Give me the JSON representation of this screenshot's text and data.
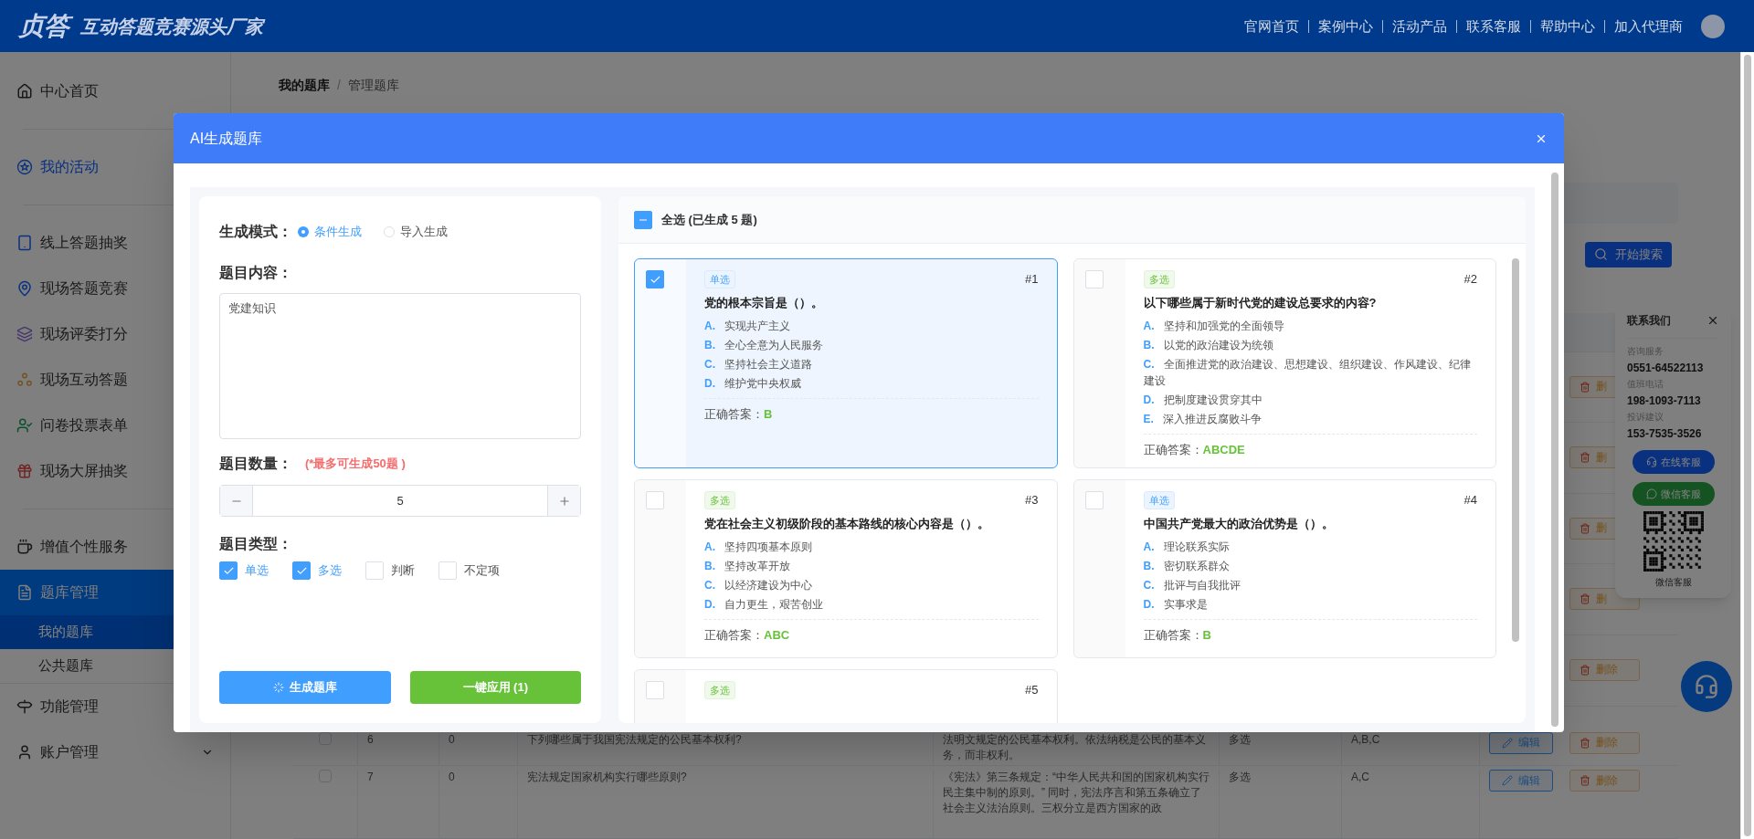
{
  "header": {
    "logo": "贞答",
    "slogan": "互动答题竞赛源头厂家",
    "nav": [
      "官网首页",
      "案例中心",
      "活动产品",
      "联系客服",
      "帮助中心",
      "加入代理商"
    ]
  },
  "sidebar": [
    {
      "kind": "link",
      "label": "中心首页"
    },
    {
      "kind": "divider"
    },
    {
      "kind": "accent",
      "label": "我的活动"
    },
    {
      "kind": "divider"
    },
    {
      "kind": "link",
      "label": "线上答题抽奖"
    },
    {
      "kind": "link",
      "label": "现场答题竞赛"
    },
    {
      "kind": "link",
      "label": "现场评委打分"
    },
    {
      "kind": "link",
      "label": "现场互动答题"
    },
    {
      "kind": "link",
      "label": "问卷投票表单"
    },
    {
      "kind": "link",
      "label": "现场大屏抽奖"
    },
    {
      "kind": "divider"
    },
    {
      "kind": "link",
      "label": "增值个性服务"
    },
    {
      "kind": "group",
      "label": "题库管理",
      "expanded": true,
      "children": [
        {
          "label": "我的题库",
          "selected": true
        },
        {
          "label": "公共题库",
          "selected": false
        }
      ]
    },
    {
      "kind": "link",
      "label": "功能管理"
    },
    {
      "kind": "group",
      "label": "账户管理",
      "expanded": false
    }
  ],
  "breadcrumb": [
    "我的题库",
    "/",
    "管理题库"
  ],
  "search_button": "开始搜索",
  "table_rows": [
    {
      "delete": "删"
    },
    {
      "delete": "删"
    },
    {
      "delete": "删"
    },
    {
      "delete": "删"
    },
    {
      "delete": "删除"
    },
    {
      "checked": false,
      "number": "6",
      "column_3": "0",
      "question": "下列哪些属于我国宪法规定的公民基本权利?",
      "explanation": "法明文规定的公民基本权利。依法纳税是公民的基本义务，而非权利。",
      "type": "多选",
      "answer": "A,B,C",
      "edit": "编辑",
      "delete": "删除"
    },
    {
      "checked": false,
      "number": "7",
      "column_3": "0",
      "question": "宪法规定国家机构实行哪些原则?",
      "explanation": "《宪法》第三条规定：“中华人民共和国的国家机构实行民主集中制的原则。” 同时，宪法序言和第五条确立了社会主义法治原则。三权分立是西方国家的政",
      "type": "多选",
      "answer": "A,C",
      "edit": "编辑",
      "delete": "删除"
    }
  ],
  "contact": {
    "title": "联系我们",
    "entries": [
      {
        "label": "咨询服务",
        "value": "0551-64522113"
      },
      {
        "label": "值班电话",
        "value": "198-1093-7113"
      },
      {
        "label": "投诉建议",
        "value": "153-7535-3526"
      }
    ],
    "online_button": "在线客服",
    "wechat_button": "微信客服",
    "qr_caption": "微信客服"
  },
  "modal": {
    "title": "AI生成题库",
    "mode_label": "生成模式：",
    "modes": [
      {
        "label": "条件生成",
        "selected": true
      },
      {
        "label": "导入生成",
        "selected": false
      }
    ],
    "content_label": "题目内容：",
    "content_value": "党建知识",
    "count_label": "题目数量：",
    "count_hint": "(*最多可生成50题 )",
    "count_value": "5",
    "type_label": "题目类型：",
    "types": [
      {
        "label": "单选",
        "checked": true
      },
      {
        "label": "多选",
        "checked": true
      },
      {
        "label": "判断",
        "checked": false
      },
      {
        "label": "不定项",
        "checked": false
      }
    ],
    "generate_button": "生成题库",
    "apply_button": "一键应用 (1)",
    "select_all": {
      "label": "全选 (已生成 5 题)",
      "indeterminate": true
    },
    "questions": [
      {
        "number": "#1",
        "tag": "单选",
        "kind": "single",
        "selected": true,
        "question": "党的根本宗旨是（）。",
        "options": [
          {
            "letter": "A.",
            "text": "实现共产主义"
          },
          {
            "letter": "B.",
            "text": "全心全意为人民服务"
          },
          {
            "letter": "C.",
            "text": "坚持社会主义道路"
          },
          {
            "letter": "D.",
            "text": "维护党中央权威"
          }
        ],
        "answer_label": "正确答案：",
        "answer": "B"
      },
      {
        "number": "#2",
        "tag": "多选",
        "kind": "multiple",
        "selected": false,
        "question": "以下哪些属于新时代党的建设总要求的内容?",
        "options": [
          {
            "letter": "A.",
            "text": "坚持和加强党的全面领导"
          },
          {
            "letter": "B.",
            "text": "以党的政治建设为统领"
          },
          {
            "letter": "C.",
            "text": "全面推进党的政治建设、思想建设、组织建设、作风建设、纪律建设"
          },
          {
            "letter": "D.",
            "text": "把制度建设贯穿其中"
          },
          {
            "letter": "E.",
            "text": "深入推进反腐败斗争"
          }
        ],
        "answer_label": "正确答案：",
        "answer": "ABCDE"
      },
      {
        "number": "#3",
        "tag": "多选",
        "kind": "multiple",
        "selected": false,
        "question": "党在社会主义初级阶段的基本路线的核心内容是（）。",
        "options": [
          {
            "letter": "A.",
            "text": "坚持四项基本原则"
          },
          {
            "letter": "B.",
            "text": "坚持改革开放"
          },
          {
            "letter": "C.",
            "text": "以经济建设为中心"
          },
          {
            "letter": "D.",
            "text": "自力更生，艰苦创业"
          }
        ],
        "answer_label": "正确答案：",
        "answer": "ABC"
      },
      {
        "number": "#4",
        "tag": "单选",
        "kind": "single",
        "selected": false,
        "question": "中国共产党最大的政治优势是（）。",
        "options": [
          {
            "letter": "A.",
            "text": "理论联系实际"
          },
          {
            "letter": "B.",
            "text": "密切联系群众"
          },
          {
            "letter": "C.",
            "text": "批评与自我批评"
          },
          {
            "letter": "D.",
            "text": "实事求是"
          }
        ],
        "answer_label": "正确答案：",
        "answer": "B"
      },
      {
        "number": "#5",
        "tag": "多选",
        "kind": "multiple",
        "selected": false
      }
    ]
  }
}
